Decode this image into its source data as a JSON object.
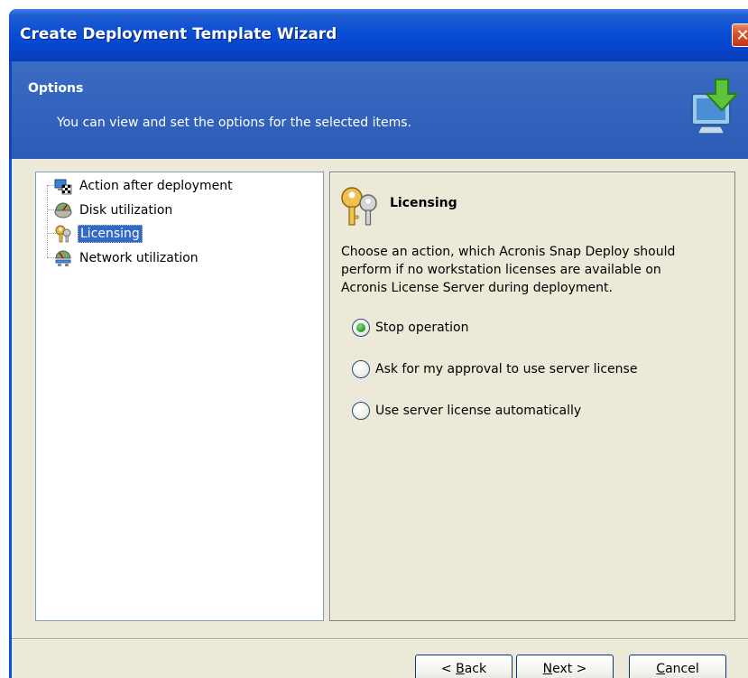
{
  "window": {
    "title": "Create Deployment Template Wizard",
    "close_symbol": "✕"
  },
  "header": {
    "title": "Options",
    "description": "You can view and set the options for the selected items.",
    "icon": "monitor-download-arrow-icon"
  },
  "tree": {
    "items": [
      {
        "label": "Action after deployment",
        "icon": "computer-flag-icon",
        "selected": false
      },
      {
        "label": "Disk utilization",
        "icon": "disk-gauge-icon",
        "selected": false
      },
      {
        "label": "Licensing",
        "icon": "keys-icon",
        "selected": true
      },
      {
        "label": "Network utilization",
        "icon": "network-gauge-icon",
        "selected": false
      }
    ]
  },
  "panel": {
    "title": "Licensing",
    "icon": "keys-icon",
    "description_lines": [
      "Choose an action, which Acronis Snap Deploy should",
      "perform if no workstation licenses are available on",
      "Acronis License Server during deployment."
    ],
    "options": [
      {
        "label": "Stop operation",
        "checked": true
      },
      {
        "label": "Ask for my approval to use server license",
        "checked": false
      },
      {
        "label": "Use server license automatically",
        "checked": false
      }
    ]
  },
  "buttons": {
    "back": {
      "accel": "B",
      "rest": "ack",
      "prefix": "< "
    },
    "next": {
      "accel": "N",
      "rest": "ext >"
    },
    "cancel": {
      "accel": "C",
      "rest": "ancel"
    }
  },
  "colors": {
    "titlebar": "#0a4ed4",
    "header": "#2c5bb5",
    "dialog_bg": "#ece9d8",
    "selection": "#316ac5"
  }
}
